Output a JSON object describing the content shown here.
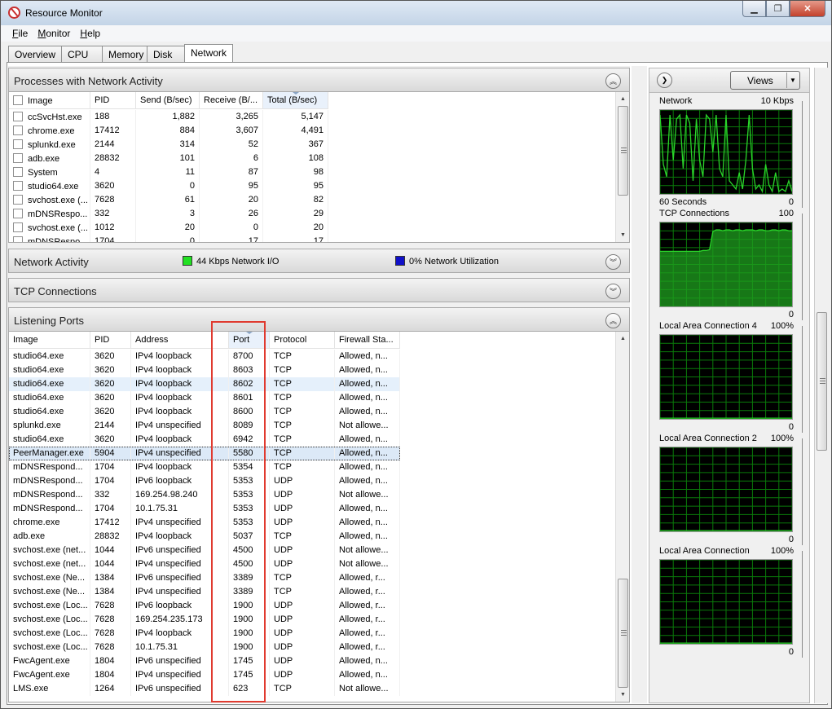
{
  "window": {
    "title": "Resource Monitor",
    "buttons": [
      "minimize",
      "restore",
      "close"
    ]
  },
  "menu": [
    {
      "label": "File",
      "accel": "F",
      "rest": "ile"
    },
    {
      "label": "Monitor",
      "accel": "M",
      "rest": "onitor"
    },
    {
      "label": "Help",
      "accel": "H",
      "rest": "elp"
    }
  ],
  "tabs": [
    "Overview",
    "CPU",
    "Memory",
    "Disk",
    "Network"
  ],
  "active_tab": "Network",
  "processes": {
    "title": "Processes with Network Activity",
    "columns": [
      "Image",
      "PID",
      "Send (B/sec)",
      "Receive (B/...",
      "Total (B/sec)"
    ],
    "sorted_column": "Total (B/sec)",
    "rows": [
      [
        "ccSvcHst.exe",
        "188",
        "1,882",
        "3,265",
        "5,147"
      ],
      [
        "chrome.exe",
        "17412",
        "884",
        "3,607",
        "4,491"
      ],
      [
        "splunkd.exe",
        "2144",
        "314",
        "52",
        "367"
      ],
      [
        "adb.exe",
        "28832",
        "101",
        "6",
        "108"
      ],
      [
        "System",
        "4",
        "11",
        "87",
        "98"
      ],
      [
        "studio64.exe",
        "3620",
        "0",
        "95",
        "95"
      ],
      [
        "svchost.exe (...",
        "7628",
        "61",
        "20",
        "82"
      ],
      [
        "mDNSRespo...",
        "332",
        "3",
        "26",
        "29"
      ],
      [
        "svchost.exe (...",
        "1012",
        "20",
        "0",
        "20"
      ],
      [
        "mDNSRespo...",
        "1704",
        "0",
        "17",
        "17"
      ]
    ]
  },
  "network_activity": {
    "title": "Network Activity",
    "io_label": "44 Kbps Network I/O",
    "io_color": "#22e022",
    "util_label": "0% Network Utilization",
    "util_color": "#1010c8"
  },
  "tcp": {
    "title": "TCP Connections"
  },
  "listening": {
    "title": "Listening Ports",
    "columns": [
      "Image",
      "PID",
      "Address",
      "Port",
      "Protocol",
      "Firewall Sta..."
    ],
    "sorted_column": "Port",
    "rows": [
      [
        "studio64.exe",
        "3620",
        "IPv4 loopback",
        "8700",
        "TCP",
        "Allowed, n..."
      ],
      [
        "studio64.exe",
        "3620",
        "IPv4 loopback",
        "8603",
        "TCP",
        "Allowed, n..."
      ],
      [
        "studio64.exe",
        "3620",
        "IPv4 loopback",
        "8602",
        "TCP",
        "Allowed, n..."
      ],
      [
        "studio64.exe",
        "3620",
        "IPv4 loopback",
        "8601",
        "TCP",
        "Allowed, n..."
      ],
      [
        "studio64.exe",
        "3620",
        "IPv4 loopback",
        "8600",
        "TCP",
        "Allowed, n..."
      ],
      [
        "splunkd.exe",
        "2144",
        "IPv4 unspecified",
        "8089",
        "TCP",
        "Not allowe..."
      ],
      [
        "studio64.exe",
        "3620",
        "IPv4 loopback",
        "6942",
        "TCP",
        "Allowed, n..."
      ],
      [
        "PeerManager.exe",
        "5904",
        "IPv4 unspecified",
        "5580",
        "TCP",
        "Allowed, n..."
      ],
      [
        "mDNSRespond...",
        "1704",
        "IPv4 loopback",
        "5354",
        "TCP",
        "Allowed, n..."
      ],
      [
        "mDNSRespond...",
        "1704",
        "IPv6 loopback",
        "5353",
        "UDP",
        "Allowed, n..."
      ],
      [
        "mDNSRespond...",
        "332",
        "169.254.98.240",
        "5353",
        "UDP",
        "Not allowe..."
      ],
      [
        "mDNSRespond...",
        "1704",
        "10.1.75.31",
        "5353",
        "UDP",
        "Allowed, n..."
      ],
      [
        "chrome.exe",
        "17412",
        "IPv4 unspecified",
        "5353",
        "UDP",
        "Allowed, n..."
      ],
      [
        "adb.exe",
        "28832",
        "IPv4 loopback",
        "5037",
        "TCP",
        "Allowed, n..."
      ],
      [
        "svchost.exe (net...",
        "1044",
        "IPv6 unspecified",
        "4500",
        "UDP",
        "Not allowe..."
      ],
      [
        "svchost.exe (net...",
        "1044",
        "IPv4 unspecified",
        "4500",
        "UDP",
        "Not allowe..."
      ],
      [
        "svchost.exe (Ne...",
        "1384",
        "IPv6 unspecified",
        "3389",
        "TCP",
        "Allowed, r..."
      ],
      [
        "svchost.exe (Ne...",
        "1384",
        "IPv4 unspecified",
        "3389",
        "TCP",
        "Allowed, r..."
      ],
      [
        "svchost.exe (Loc...",
        "7628",
        "IPv6 loopback",
        "1900",
        "UDP",
        "Allowed, r..."
      ],
      [
        "svchost.exe (Loc...",
        "7628",
        "169.254.235.173",
        "1900",
        "UDP",
        "Allowed, r..."
      ],
      [
        "svchost.exe (Loc...",
        "7628",
        "IPv4 loopback",
        "1900",
        "UDP",
        "Allowed, r..."
      ],
      [
        "svchost.exe (Loc...",
        "7628",
        "10.1.75.31",
        "1900",
        "UDP",
        "Allowed, r..."
      ],
      [
        "FwcAgent.exe",
        "1804",
        "IPv6 unspecified",
        "1745",
        "UDP",
        "Allowed, n..."
      ],
      [
        "FwcAgent.exe",
        "1804",
        "IPv4 unspecified",
        "1745",
        "UDP",
        "Allowed, n..."
      ],
      [
        "LMS.exe",
        "1264",
        "IPv6 unspecified",
        "623",
        "TCP",
        "Not allowe..."
      ]
    ],
    "selected_row_index": 2,
    "focused_row_index": 7
  },
  "side": {
    "views_label": "Views",
    "graphs": [
      {
        "title": "Network",
        "max": "10 Kbps",
        "min": "0",
        "footer": "60 Seconds",
        "kind": "spiky",
        "line_color": "#2ad42a",
        "values": [
          0.95,
          0.35,
          0.2,
          0.95,
          0.4,
          0.9,
          0.95,
          0.3,
          0.95,
          0.85,
          0.15,
          0.9,
          0.4,
          0.2,
          0.95,
          0.9,
          0.5,
          0.95,
          0.3,
          0.2,
          0.95,
          0.15,
          0.1,
          0.05,
          0.25,
          0.05,
          0.4,
          0.95,
          0.3,
          0.05,
          0.1,
          0.02,
          0.35,
          0.1,
          0.02,
          0.25,
          0.02,
          0.05,
          0.02,
          0.15,
          0.02
        ]
      },
      {
        "title": "TCP Connections",
        "max": "100",
        "min": "0",
        "kind": "tcp",
        "line_color": "#2ad42a",
        "values": [
          0.66,
          0.66,
          0.66,
          0.66,
          0.66,
          0.66,
          0.66,
          0.66,
          0.66,
          0.66,
          0.66,
          0.66,
          0.66,
          0.67,
          0.67,
          0.68,
          0.9,
          0.92,
          0.92,
          0.91,
          0.92,
          0.92,
          0.91,
          0.92,
          0.92,
          0.91,
          0.92,
          0.92,
          0.92,
          0.91,
          0.92,
          0.92,
          0.91,
          0.91,
          0.92,
          0.92,
          0.91,
          0.92,
          0.92,
          0.91,
          0.91
        ]
      },
      {
        "title": "Local Area Connection 4",
        "max": "100%",
        "min": "0",
        "kind": "flat",
        "line_color": "#2ad42a",
        "values": [
          0,
          0
        ]
      },
      {
        "title": "Local Area Connection 2",
        "max": "100%",
        "min": "0",
        "kind": "flat",
        "line_color": "#2ad42a",
        "values": [
          0,
          0
        ]
      },
      {
        "title": "Local Area Connection",
        "max": "100%",
        "min": "0",
        "kind": "flat",
        "line_color": "#2ad42a",
        "values": [
          0,
          0
        ]
      }
    ]
  }
}
